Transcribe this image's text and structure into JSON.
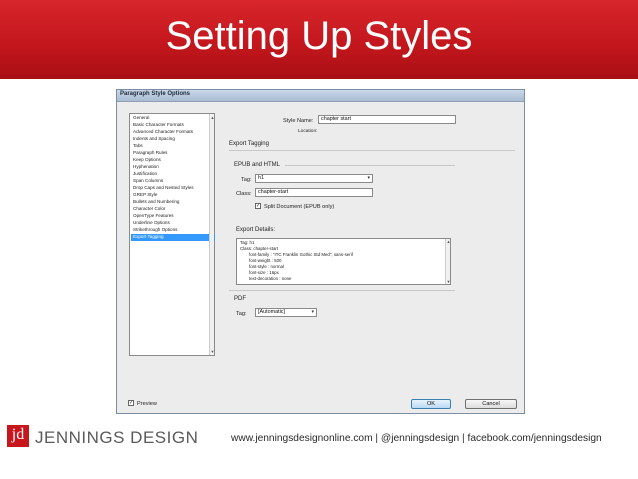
{
  "slide": {
    "title": "Setting Up Styles"
  },
  "dialog": {
    "title": "Paragraph Style Options",
    "categories": [
      "General",
      "Basic Character Formats",
      "Advanced Character Formats",
      "Indents and Spacing",
      "Tabs",
      "Paragraph Rules",
      "Keep Options",
      "Hyphenation",
      "Justification",
      "Span Columns",
      "Drop Caps and Nested Styles",
      "GREP Style",
      "Bullets and Numbering",
      "Character Color",
      "OpenType Features",
      "Underline Options",
      "Strikethrough Options",
      "Export Tagging"
    ],
    "selected_category": "Export Tagging",
    "style_name_label": "Style Name:",
    "style_name_value": "chapter start",
    "location_label": "Location:",
    "section_title": "Export Tagging",
    "epub_heading": "EPUB and HTML",
    "tag_label": "Tag:",
    "tag_value": "h1",
    "class_label": "Class:",
    "class_value": "chapter-start",
    "split_document_label": "Split Document (EPUB only)",
    "split_document_checked": "✓",
    "export_details_label": "Export Details:",
    "export_details_lines": [
      "Tag: h1",
      "Class: chapter-start",
      "font-family : \"ITC Franklin Gothic Std Med\", sans-serif",
      "font-weight : 500",
      "font-style : normal",
      "font-size : 16px",
      "text-decoration : none"
    ],
    "pdf_heading": "PDF",
    "pdf_tag_label": "Tag:",
    "pdf_tag_value": "[Automatic]",
    "preview_label": "Preview",
    "preview_checked": "✓",
    "ok_label": "OK",
    "cancel_label": "Cancel"
  },
  "footer": {
    "logo_mark": "jd",
    "company": "JENNINGS DESIGN",
    "links": "www.jenningsdesignonline.com | @jenningsdesign | facebook.com/jenningsdesign"
  },
  "colors": {
    "banner_red": "#c1161c",
    "selection_blue": "#3399ff"
  }
}
